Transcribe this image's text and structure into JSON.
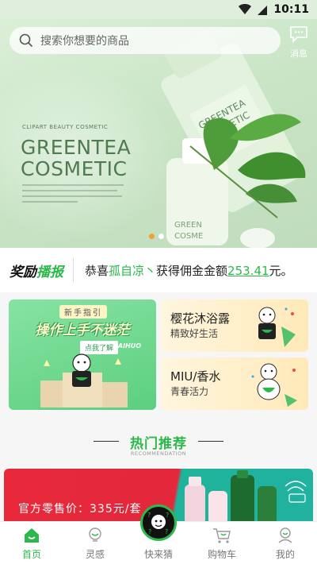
{
  "status_bar": {
    "time": "10:11"
  },
  "search": {
    "placeholder": "搜索你想要的商品"
  },
  "message": {
    "label": "消息"
  },
  "banner": {
    "subtitle": "CLIPART BEAUTY COSMETIC",
    "title_line1": "GREENTEA",
    "title_line2": "COSMETIC",
    "bottle_text_1": "GREENTEA",
    "bottle_text_2": "COSMETIC",
    "slide_count": 2,
    "active_slide": 1
  },
  "ticker": {
    "logo_part1": "奖励",
    "logo_part2": "播报",
    "prefix": "恭喜",
    "name": "孤自凉丶",
    "middle": "获得佣金金额",
    "amount": "253.41",
    "suffix": "元。"
  },
  "guide_card": {
    "tag": "新手指引",
    "title": "操作上手不迷茫",
    "button": "点我了解",
    "brand": "CAIHUO"
  },
  "category_cards": [
    {
      "title": "樱花沐浴露",
      "subtitle": "精致好生活"
    },
    {
      "title": "MIU/香水",
      "subtitle": "青春活力"
    }
  ],
  "section": {
    "title": "热门推荐",
    "subtitle": "RECOMMENDATION"
  },
  "promo": {
    "price_label": "官方零售价：335元/套"
  },
  "bottom_nav": [
    {
      "label": "首页",
      "icon": "home-icon",
      "active": true
    },
    {
      "label": "灵感",
      "icon": "bulb-icon",
      "active": false
    },
    {
      "label": "快来猜",
      "icon": "guess-badge-icon",
      "active": false
    },
    {
      "label": "购物车",
      "icon": "cart-icon",
      "active": false
    },
    {
      "label": "我的",
      "icon": "profile-icon",
      "active": false
    }
  ],
  "colors": {
    "accent": "#2db84b",
    "banner_bg": "#c9e5c6",
    "promo_red": "#e8293b",
    "promo_teal": "#1fb39b"
  }
}
